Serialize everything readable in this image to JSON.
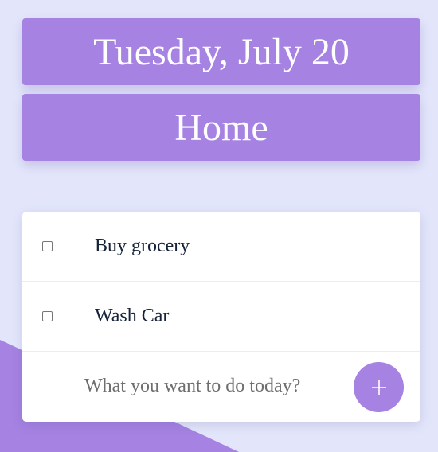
{
  "header": {
    "date": "Tuesday, July 20",
    "title": "Home"
  },
  "todos": [
    {
      "label": "Buy grocery",
      "checked": false
    },
    {
      "label": "Wash Car",
      "checked": false
    }
  ],
  "add_form": {
    "placeholder": "What you want to do today?",
    "button_icon": "plus-icon"
  },
  "colors": {
    "accent": "#a682e2",
    "background": "#e3e6fb",
    "card": "#ffffff",
    "text": "#152238"
  }
}
